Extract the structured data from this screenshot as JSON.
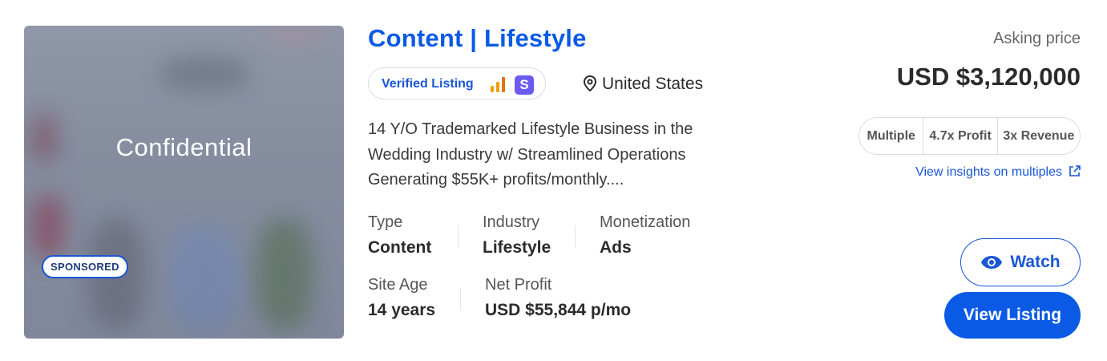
{
  "listing": {
    "thumbnail_text": "Confidential",
    "sponsored_badge": "SPONSORED",
    "title": "Content | Lifestyle",
    "verified_label": "Verified Listing",
    "verified_icons": [
      "analytics-bars-icon",
      "shopify-s-icon"
    ],
    "location": "United States",
    "description": "14 Y/O Trademarked Lifestyle Business in the Wedding Industry w/ Streamlined Operations Generating $55K+ profits/monthly....",
    "fields": {
      "type": {
        "label": "Type",
        "value": "Content"
      },
      "industry": {
        "label": "Industry",
        "value": "Lifestyle"
      },
      "monetization": {
        "label": "Monetization",
        "value": "Ads"
      },
      "site_age": {
        "label": "Site Age",
        "value": "14 years"
      },
      "net_profit": {
        "label": "Net Profit",
        "value": "USD $55,844 p/mo"
      }
    }
  },
  "pricing": {
    "asking_label": "Asking price",
    "asking_price": "USD $3,120,000",
    "multiples": [
      "Multiple",
      "4.7x Profit",
      "3x Revenue"
    ],
    "insights_link": "View insights on multiples"
  },
  "actions": {
    "watch_label": "Watch",
    "view_label": "View Listing"
  },
  "colors": {
    "accent": "#0a5ae6",
    "link": "#1a56d6",
    "shopify_badge": "#6b5cf1"
  }
}
